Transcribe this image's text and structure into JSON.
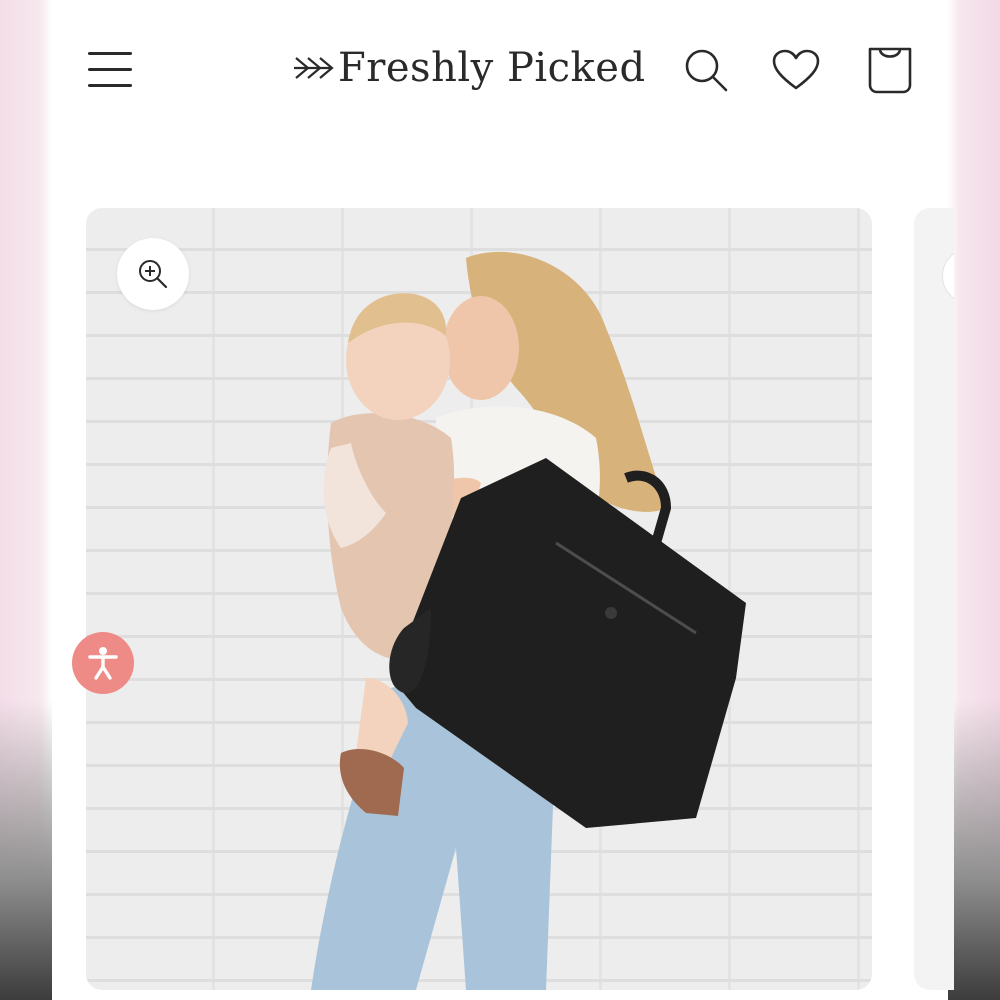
{
  "header": {
    "brand": "Freshly Picked",
    "menu_icon": "hamburger-menu-icon",
    "search_icon": "search-icon",
    "wishlist_icon": "heart-icon",
    "cart_icon": "shopping-bag-icon"
  },
  "gallery": {
    "zoom_icon": "zoom-in-icon",
    "image_subject": "product-photo-woman-with-toddler-wearing-black-backpack"
  },
  "accessibility": {
    "icon": "accessibility-person-icon",
    "color": "#ee8b86"
  },
  "colors": {
    "text": "#2a2a2a",
    "page_bg": "#ffffff",
    "side_tint": "#f3dde8"
  }
}
